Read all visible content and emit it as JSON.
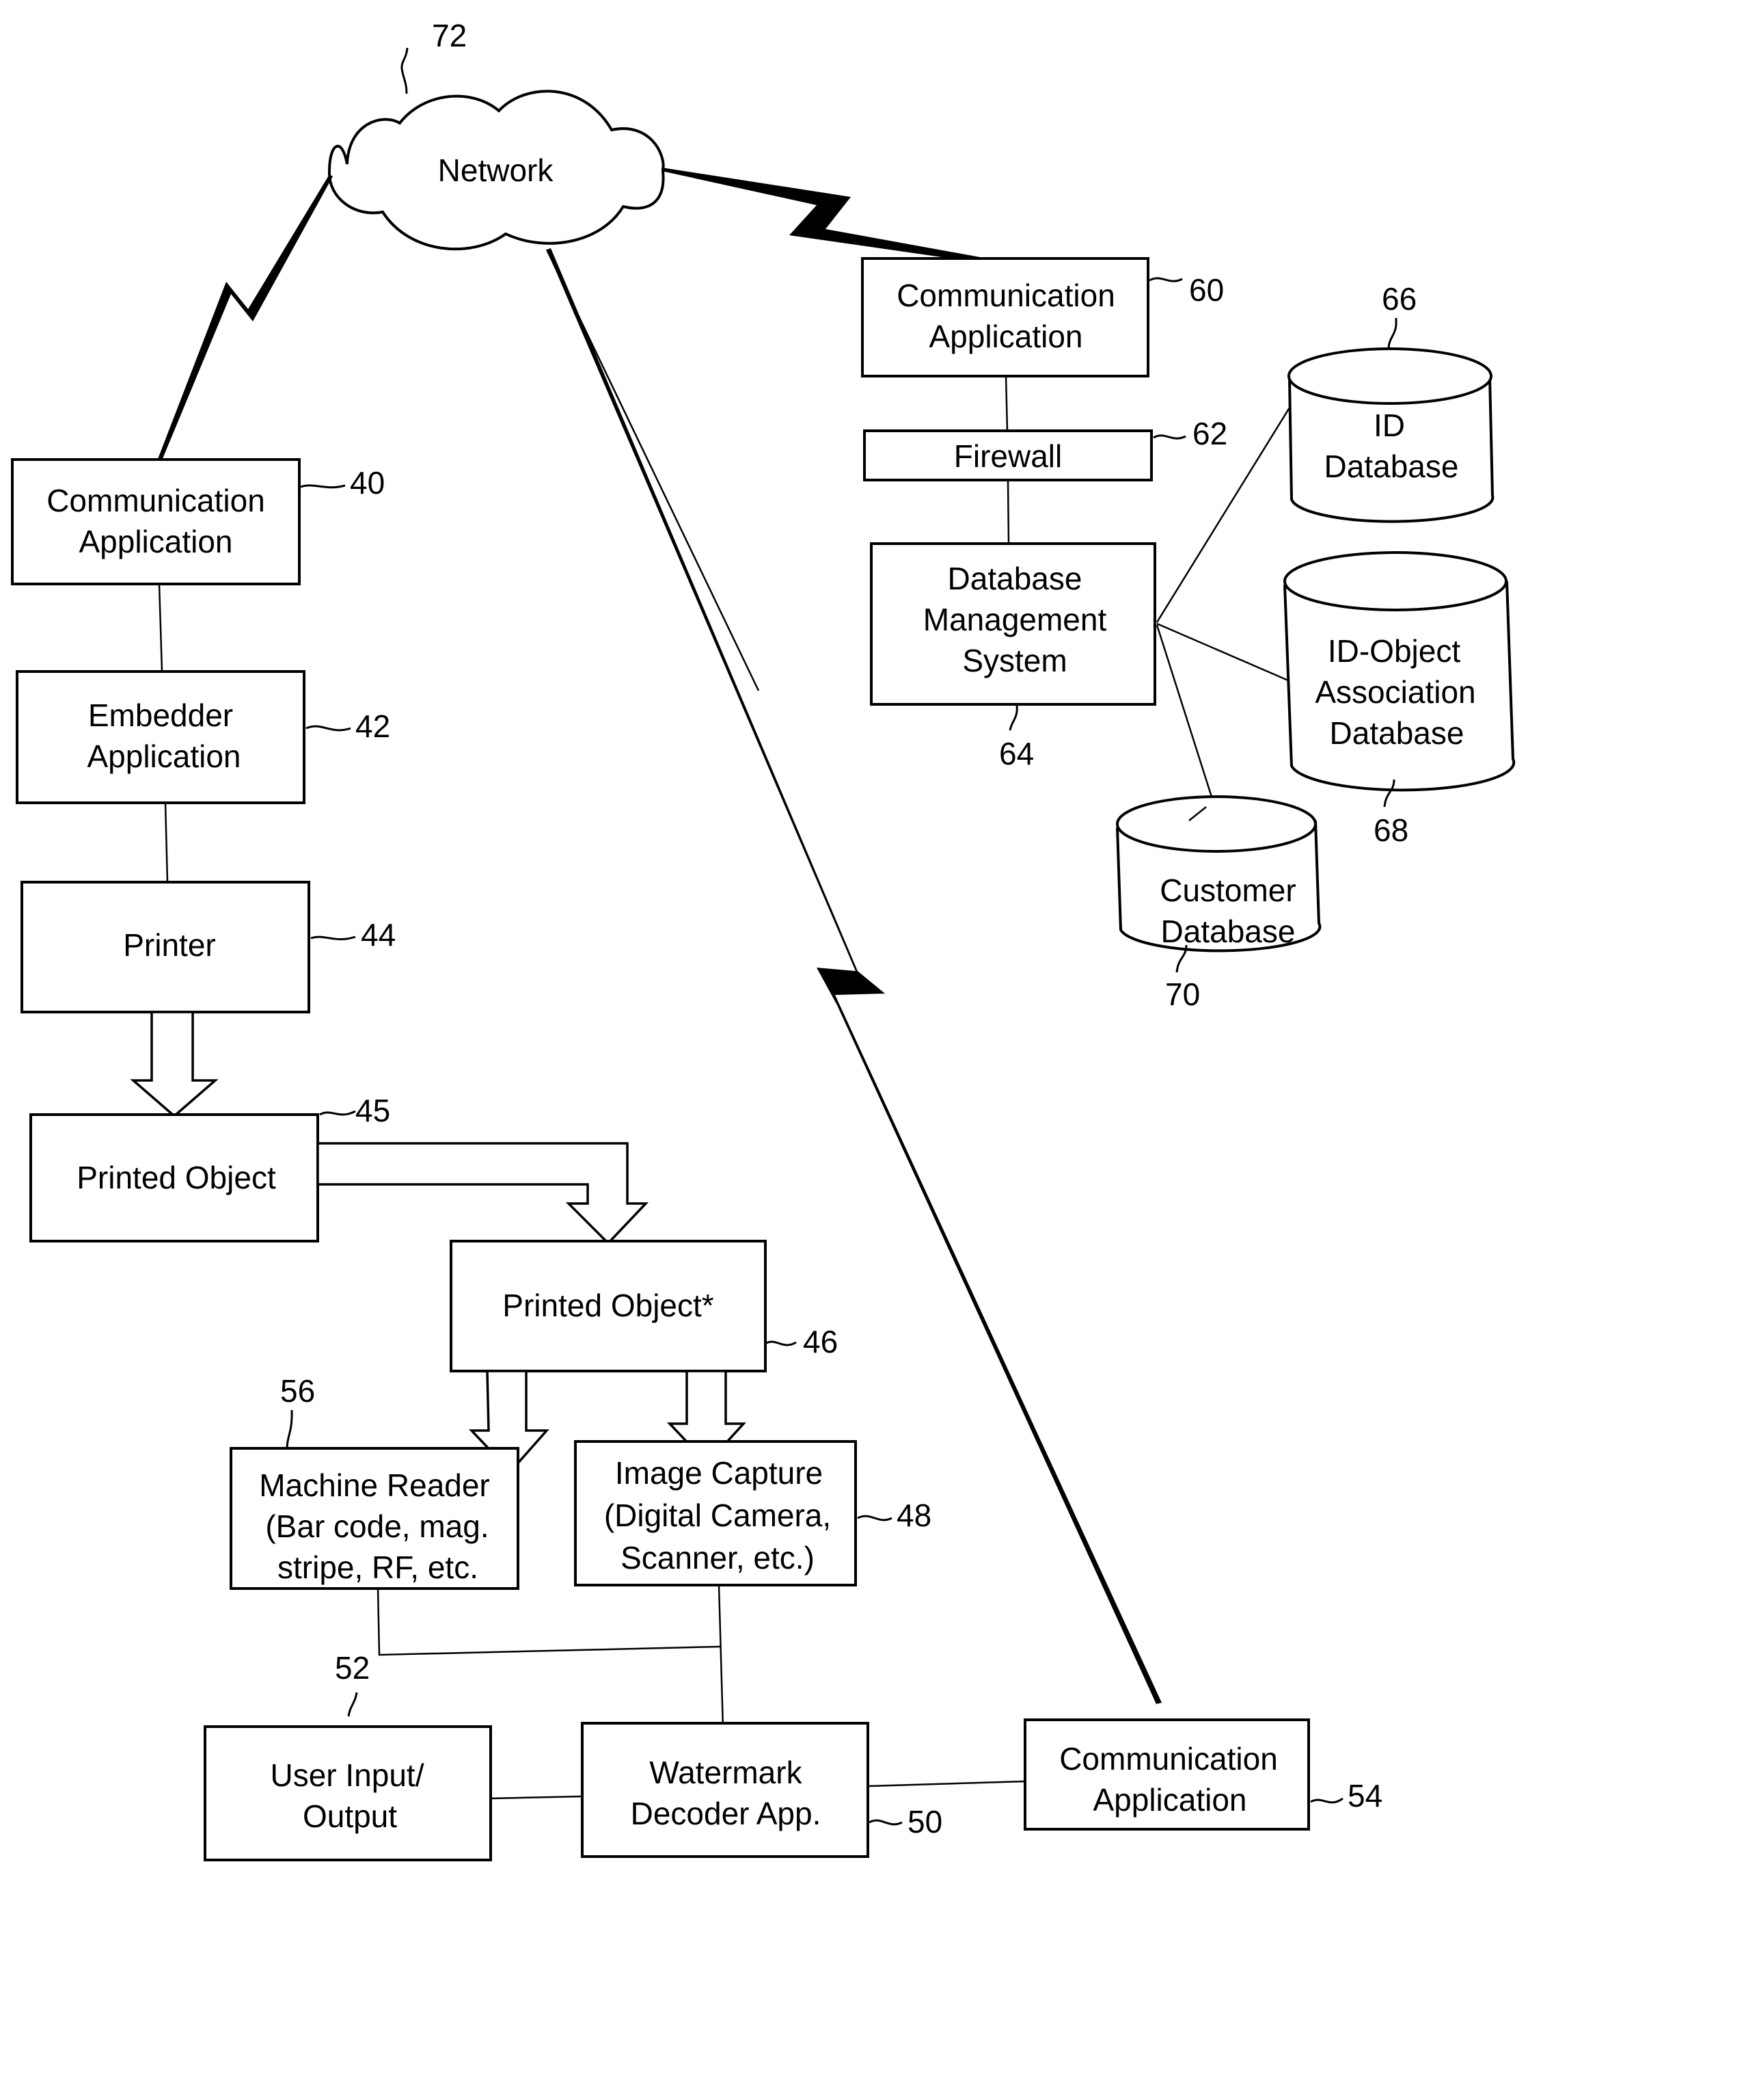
{
  "diagram": {
    "network": {
      "label": "Network",
      "ref": "72"
    },
    "server_side": {
      "communication_application": {
        "lines": [
          "Communication",
          "Application"
        ],
        "ref": "60"
      },
      "firewall": {
        "lines": [
          "Firewall"
        ],
        "ref": "62"
      },
      "dbms": {
        "lines": [
          "Database",
          "Management",
          "System"
        ],
        "ref": "64"
      },
      "id_database": {
        "lines": [
          "ID",
          "Database"
        ],
        "ref": "66"
      },
      "id_object_database": {
        "lines": [
          "ID-Object",
          "Association",
          "Database"
        ],
        "ref": "68"
      },
      "customer_database": {
        "lines": [
          "Customer",
          "Database"
        ],
        "ref": "70"
      }
    },
    "embedding_side": {
      "communication_application": {
        "lines": [
          "Communication",
          "Application"
        ],
        "ref": "40"
      },
      "embedder_application": {
        "lines": [
          "Embedder",
          "Application"
        ],
        "ref": "42"
      },
      "printer": {
        "lines": [
          "Printer"
        ],
        "ref": "44"
      },
      "printed_object": {
        "lines": [
          "Printed Object"
        ],
        "ref": "45"
      }
    },
    "reading_side": {
      "printed_object_star": {
        "lines": [
          "Printed Object*"
        ],
        "ref": "46"
      },
      "machine_reader": {
        "lines": [
          "Machine Reader",
          "(Bar code, mag.",
          "stripe, RF, etc."
        ],
        "ref": "56"
      },
      "image_capture": {
        "lines": [
          "Image Capture",
          "(Digital Camera,",
          "Scanner, etc.)"
        ],
        "ref": "48"
      },
      "user_io": {
        "lines": [
          "User Input/",
          "Output"
        ],
        "ref": "52"
      },
      "watermark_decoder": {
        "lines": [
          "Watermark",
          "Decoder App."
        ],
        "ref": "50"
      },
      "communication_application": {
        "lines": [
          "Communication",
          "Application"
        ],
        "ref": "54"
      }
    }
  }
}
